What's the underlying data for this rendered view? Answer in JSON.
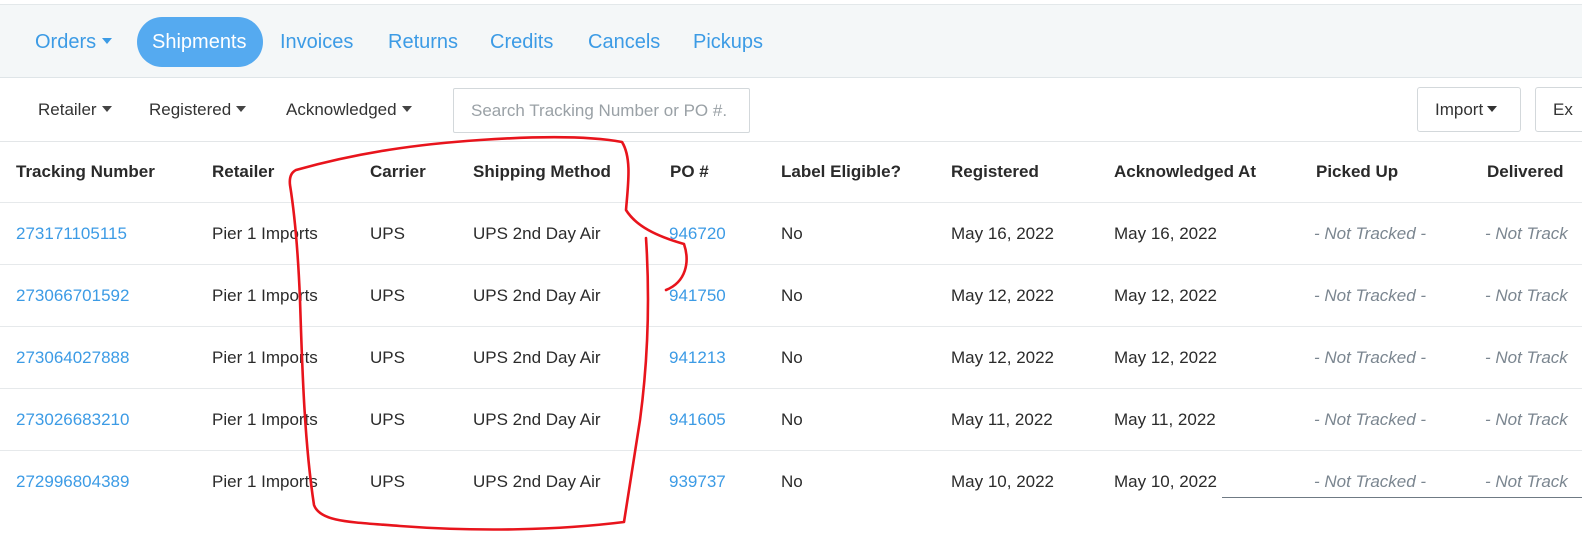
{
  "nav": {
    "tabs": [
      {
        "label": "Orders",
        "has_dropdown": true,
        "active": false
      },
      {
        "label": "Shipments",
        "active": true
      },
      {
        "label": "Invoices",
        "active": false
      },
      {
        "label": "Returns",
        "active": false
      },
      {
        "label": "Credits",
        "active": false
      },
      {
        "label": "Cancels",
        "active": false
      },
      {
        "label": "Pickups",
        "active": false
      }
    ]
  },
  "toolbar": {
    "filters": [
      "Retailer",
      "Registered",
      "Acknowledged"
    ],
    "search": {
      "placeholder": "Search Tracking Number or PO #.",
      "value": ""
    },
    "import_label": "Import",
    "export_label": "Ex"
  },
  "table": {
    "columns": [
      "Tracking Number",
      "Retailer",
      "Carrier",
      "Shipping Method",
      "PO #",
      "Label Eligible?",
      "Registered",
      "Acknowledged At",
      "Picked Up",
      "Delivered"
    ],
    "rows": [
      {
        "tracking": "273171105115",
        "retailer": "Pier 1 Imports",
        "carrier": "UPS",
        "method": "UPS 2nd Day Air",
        "po": "946720",
        "label_eligible": "No",
        "registered": "May 16, 2022",
        "acknowledged": "May 16, 2022",
        "picked_up": "- Not Tracked -",
        "delivered": "- Not Track"
      },
      {
        "tracking": "273066701592",
        "retailer": "Pier 1 Imports",
        "carrier": "UPS",
        "method": "UPS 2nd Day Air",
        "po": "941750",
        "label_eligible": "No",
        "registered": "May 12, 2022",
        "acknowledged": "May 12, 2022",
        "picked_up": "- Not Tracked -",
        "delivered": "- Not Track"
      },
      {
        "tracking": "273064027888",
        "retailer": "Pier 1 Imports",
        "carrier": "UPS",
        "method": "UPS 2nd Day Air",
        "po": "941213",
        "label_eligible": "No",
        "registered": "May 12, 2022",
        "acknowledged": "May 12, 2022",
        "picked_up": "- Not Tracked -",
        "delivered": "- Not Track"
      },
      {
        "tracking": "273026683210",
        "retailer": "Pier 1 Imports",
        "carrier": "UPS",
        "method": "UPS 2nd Day Air",
        "po": "941605",
        "label_eligible": "No",
        "registered": "May 11, 2022",
        "acknowledged": "May 11, 2022",
        "picked_up": "- Not Tracked -",
        "delivered": "- Not Track"
      },
      {
        "tracking": "272996804389",
        "retailer": "Pier 1 Imports",
        "carrier": "UPS",
        "method": "UPS 2nd Day Air",
        "po": "939737",
        "label_eligible": "No",
        "registered": "May 10, 2022",
        "acknowledged": "May 10, 2022",
        "picked_up": "- Not Tracked -",
        "delivered": "- Not Track"
      }
    ]
  },
  "colors": {
    "accent": "#3c9be5",
    "active_tab_bg": "#55aaf0",
    "nav_bg": "#f4f7f8",
    "muted_text": "#7b8690",
    "annotation": "#e8141c"
  }
}
